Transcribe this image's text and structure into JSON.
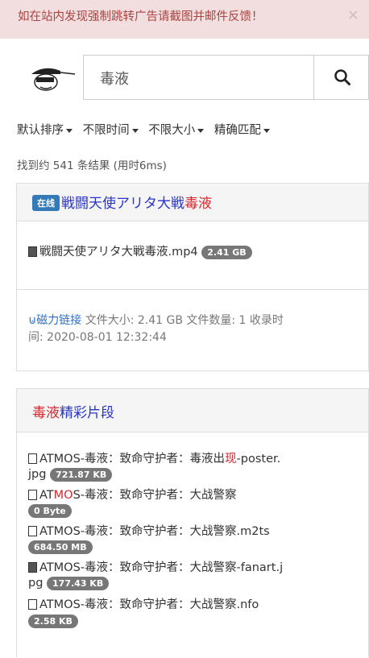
{
  "alert": {
    "text": "如在站内发现强制跳转广告请截图并邮件反馈！",
    "close": "×"
  },
  "search": {
    "query": "毒液"
  },
  "filters": [
    "默认排序",
    "不限时间",
    "不限大小",
    "精确匹配"
  ],
  "result_count": "找到约 541 条结果 (用时6ms)",
  "results": [
    {
      "badge": "在线",
      "title_pre": "戦闘天使アリタ大戦",
      "title_hl": "毒液",
      "files": [
        {
          "name": "戦闘天使アリタ大戦毒液.mp4",
          "size": "2.41 GB"
        }
      ],
      "magnet_label": "磁力链接",
      "meta_line1": "文件大小: 2.41 GB 文件数量: 1 收录时",
      "meta_line2": "间: 2020-08-01 12:32:44"
    },
    {
      "title_hl": "毒液",
      "title_post": "精彩片段",
      "files": [
        {
          "part1": "ATMOS-毒液：致命守护者：毒液出",
          "part1_hl": "现",
          "part1_post": "-poster.",
          "part2": "jpg",
          "size": "721.87 KB"
        },
        {
          "part1": "AT",
          "part1_hl": "MO",
          "part1_post": "S-毒液：致命守护者：大战警察",
          "size": "0 Byte"
        },
        {
          "part1": "ATMOS-毒液：致命守护者：大战警察.m2ts",
          "size": "684.50 MB"
        },
        {
          "part1": "ATMOS-毒液：致命守护者：大战警察-fanart.j",
          "part2": "pg",
          "size": "177.43 KB"
        },
        {
          "part1": "ATMOS-毒液：致命守护者：大战警察.nfo",
          "size": "2.58 KB"
        }
      ]
    }
  ]
}
